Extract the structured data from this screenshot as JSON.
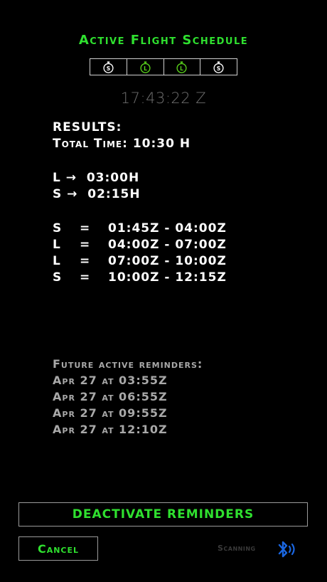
{
  "header": {
    "title": "Active Flight Schedule",
    "legs": [
      {
        "letter": "S",
        "color": "#ffffff"
      },
      {
        "letter": "L",
        "color": "#59d21b"
      },
      {
        "letter": "L",
        "color": "#59d21b"
      },
      {
        "letter": "S",
        "color": "#ffffff"
      }
    ],
    "clock": "17:43:22 Z"
  },
  "results": {
    "heading": "RESULTS:",
    "total_time": "Total Time: 10:30 H",
    "summary": [
      {
        "text": "L →  03:00H"
      },
      {
        "text": "S →  02:15H"
      }
    ],
    "segments": [
      {
        "type": "S",
        "eq": "=",
        "range": "01:45Z - 04:00Z"
      },
      {
        "type": "L",
        "eq": "=",
        "range": "04:00Z - 07:00Z"
      },
      {
        "type": "L",
        "eq": "=",
        "range": "07:00Z - 10:00Z"
      },
      {
        "type": "S",
        "eq": "=",
        "range": "10:00Z - 12:15Z"
      }
    ]
  },
  "reminders": {
    "heading": "Future active reminders:",
    "items": [
      "Apr 27 at 03:55Z",
      "Apr 27 at 06:55Z",
      "Apr 27 at 09:55Z",
      "Apr 27 at 12:10Z"
    ]
  },
  "actions": {
    "deactivate_label": "DEACTIVATE REMINDERS",
    "cancel_label": "Cancel",
    "scanning_label": "Scanning",
    "bluetooth_icon": "bluetooth-icon",
    "accent_color": "#2fe02f",
    "bluetooth_color": "#1a66e0"
  }
}
